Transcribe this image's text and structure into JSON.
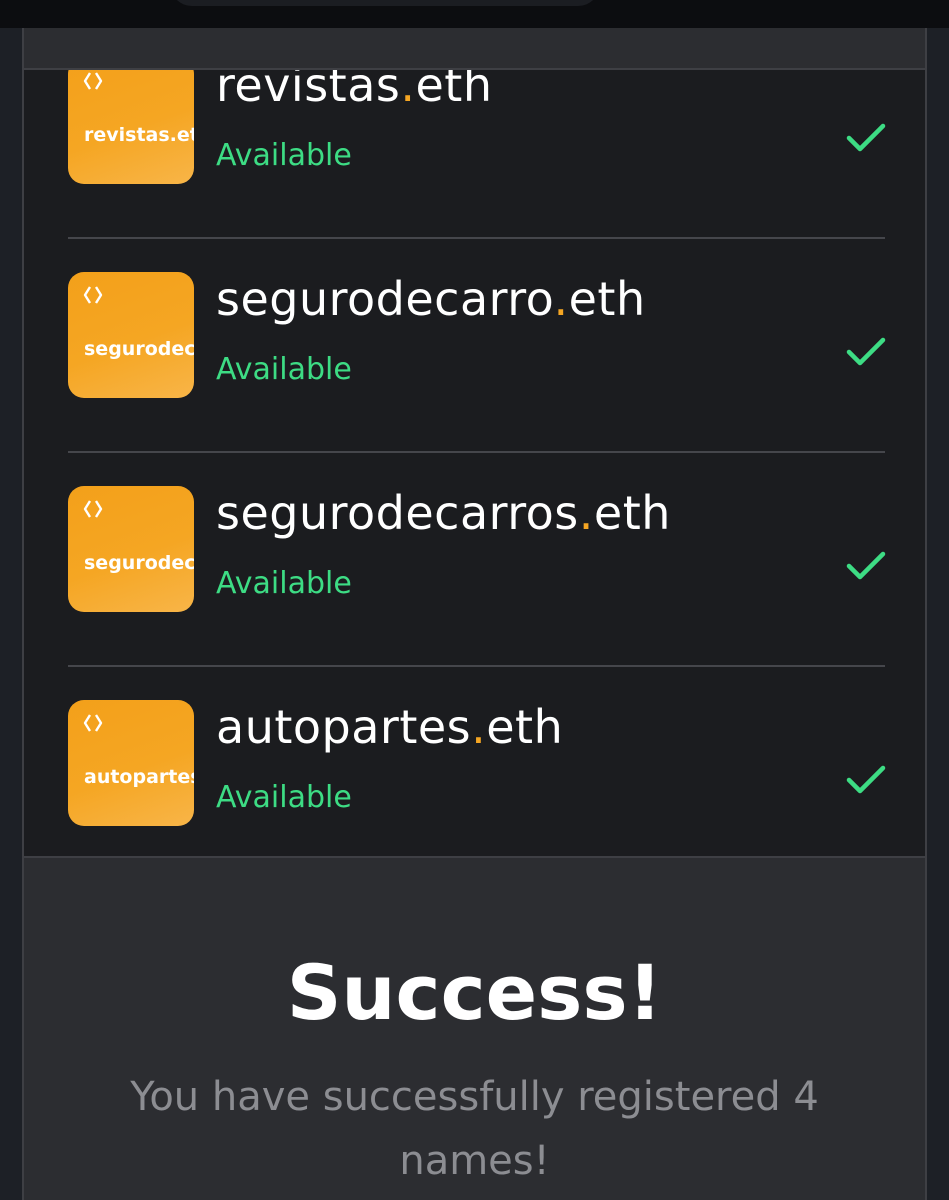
{
  "names": [
    {
      "thumb_label": "revistas.eth",
      "label": "revistas",
      "tld": "eth",
      "status": "Available",
      "icon": "check-icon"
    },
    {
      "thumb_label": "segurodecarro.eth",
      "label": "segurodecarro",
      "tld": "eth",
      "status": "Available",
      "icon": "check-icon"
    },
    {
      "thumb_label": "segurodecarros.eth",
      "label": "segurodecarros",
      "tld": "eth",
      "status": "Available",
      "icon": "check-icon"
    },
    {
      "thumb_label": "autopartes.eth",
      "label": "autopartes",
      "tld": "eth",
      "status": "Available",
      "icon": "check-icon"
    }
  ],
  "dot": ".",
  "success": {
    "title": "Success!",
    "message": "You have successfully registered 4 names!"
  },
  "colors": {
    "accent": "#f5a623",
    "available": "#3ddc84",
    "background": "#1b1c1f",
    "panel": "#2c2d31"
  }
}
